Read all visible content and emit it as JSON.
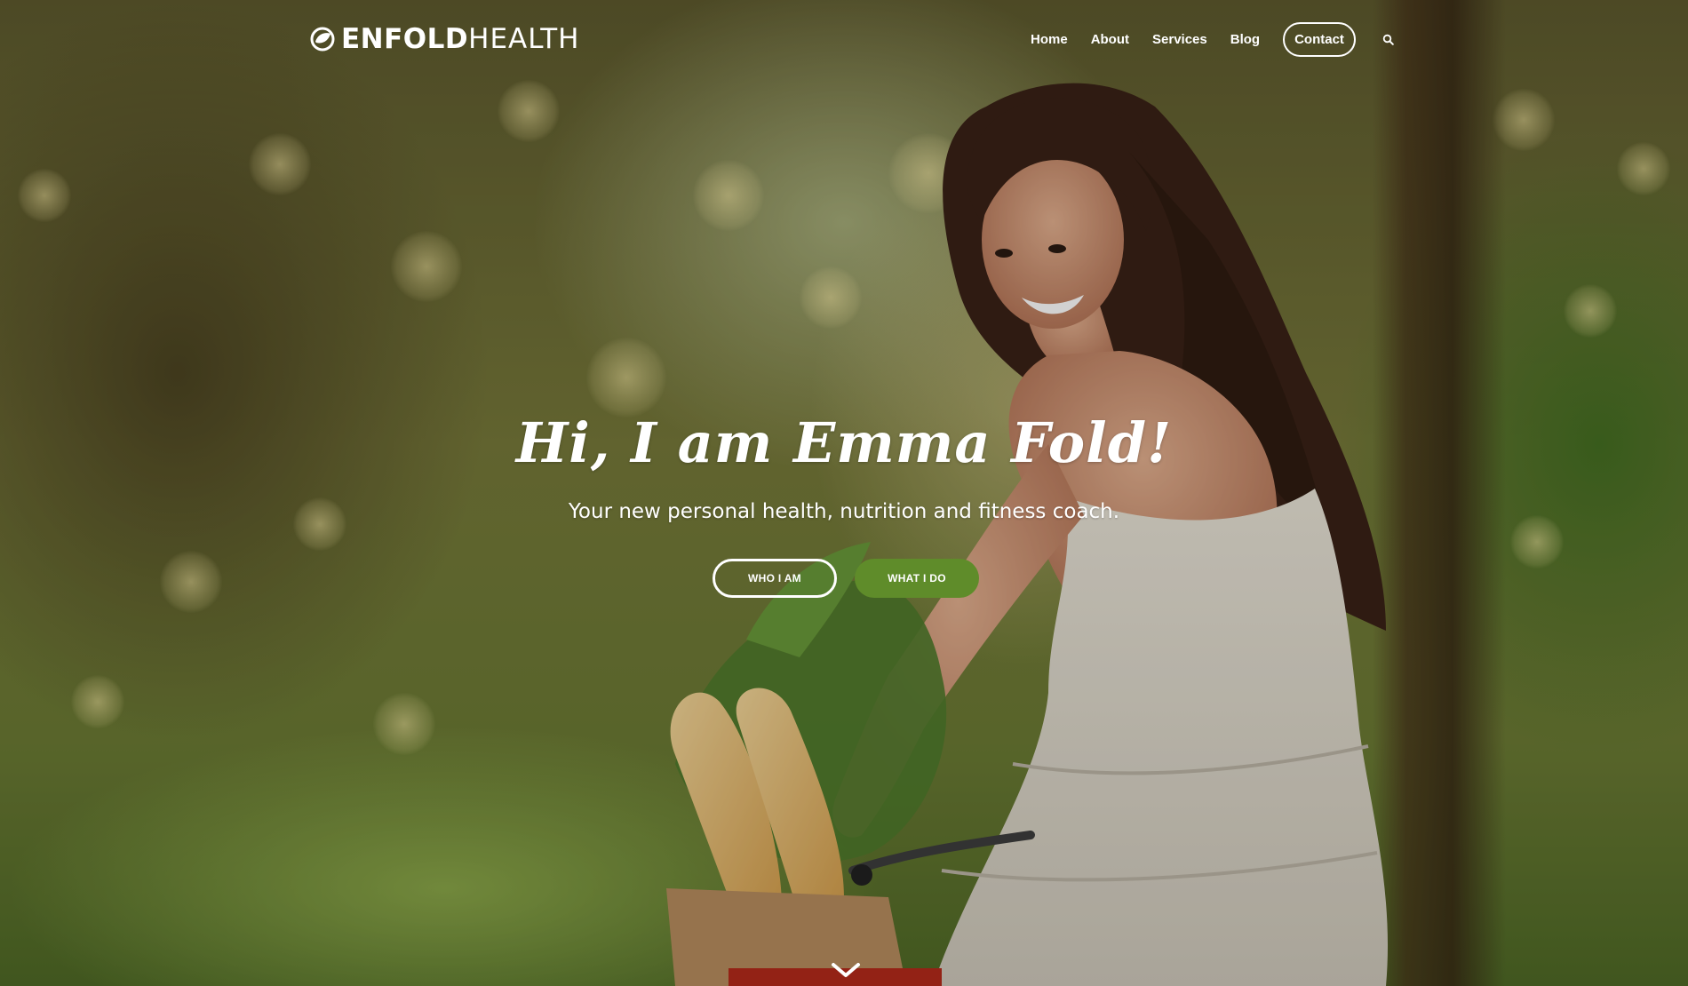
{
  "brand": {
    "name_strong": "ENFOLD",
    "name_light": "HEALTH",
    "logo_icon": "leaf-logo-icon"
  },
  "nav": {
    "items": [
      {
        "label": "Home"
      },
      {
        "label": "About"
      },
      {
        "label": "Services"
      },
      {
        "label": "Blog"
      }
    ],
    "contact_label": "Contact",
    "search_icon": "search-icon"
  },
  "hero": {
    "title": "Hi, I am Emma Fold!",
    "subtitle": "Your new personal health, nutrition and fitness coach.",
    "buttons": {
      "primary_label": "WHO I AM",
      "secondary_label": "WHAT I DO"
    },
    "scroll_icon": "chevron-down-icon"
  },
  "colors": {
    "accent": "#5f8c2a",
    "text": "#ffffff"
  }
}
